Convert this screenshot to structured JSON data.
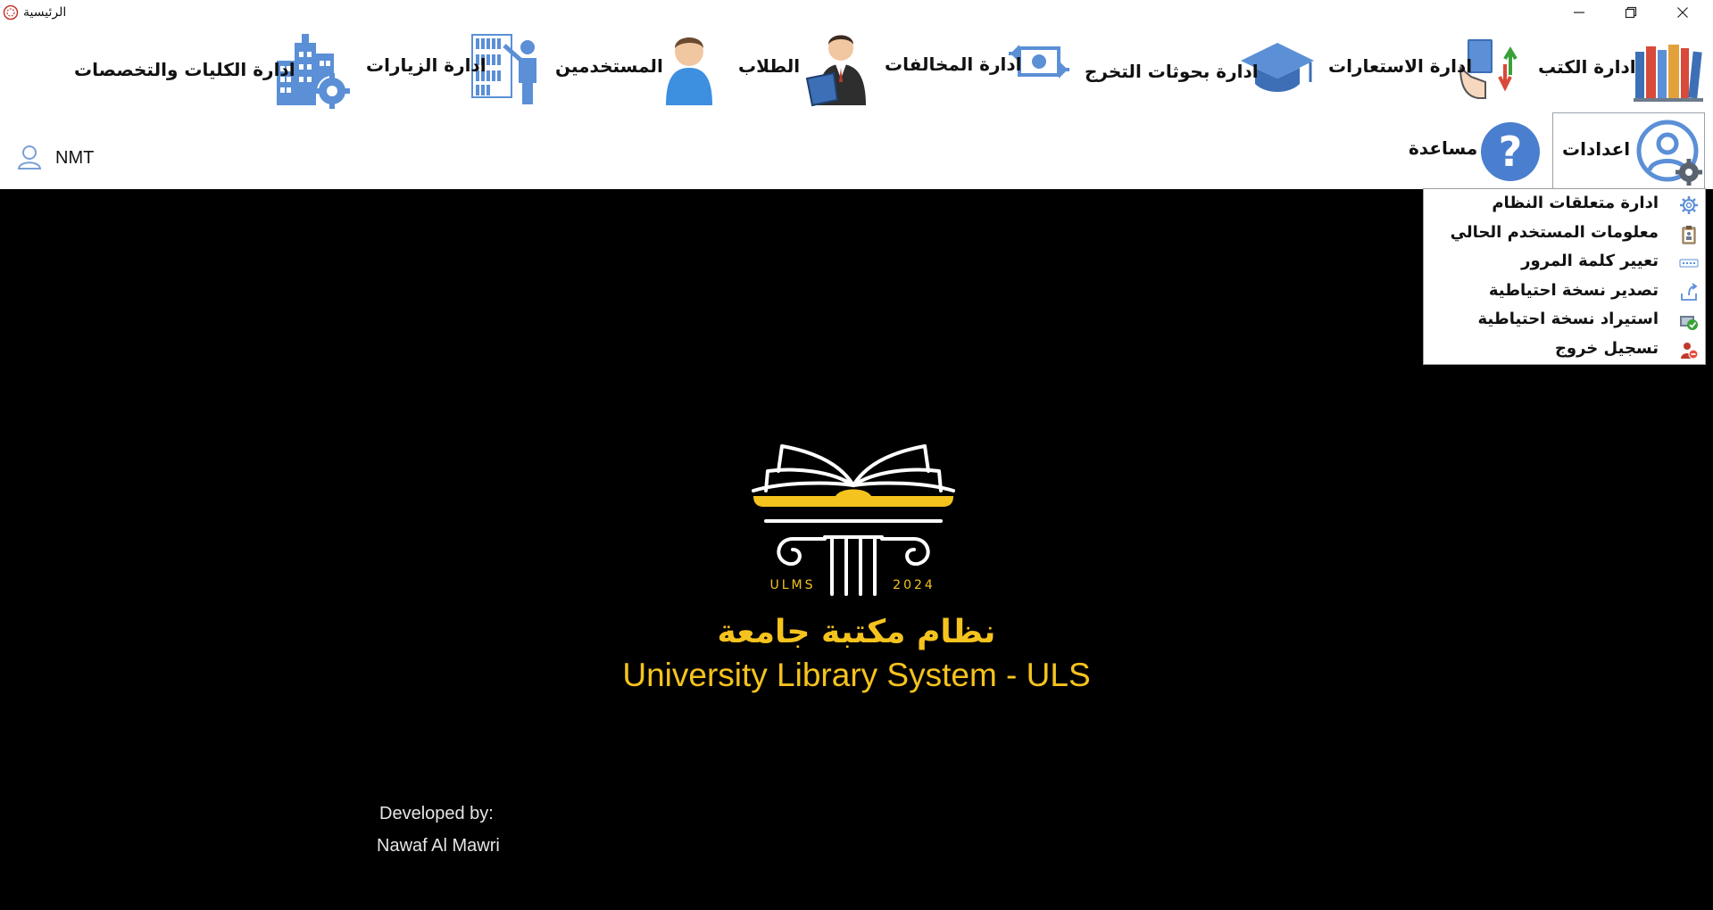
{
  "window": {
    "title": "الرئيسية"
  },
  "toolbar": {
    "items": [
      {
        "label": "ادارة الكتب",
        "icon": "books-icon"
      },
      {
        "label": "ادارة الاستعارات",
        "icon": "borrow-book-icon"
      },
      {
        "label": "ادارة بحوثات التخرج",
        "icon": "graduation-cap-icon"
      },
      {
        "label": "ادارة المخالفات",
        "icon": "money-exchange-icon"
      },
      {
        "label": "الطلاب",
        "icon": "student-reading-icon"
      },
      {
        "label": "المستخدمين",
        "icon": "user-icon"
      },
      {
        "label": "ادارة الزيارات",
        "icon": "library-visitor-icon"
      },
      {
        "label": "ادارة الكليات والتخصصات",
        "icon": "building-gear-icon"
      }
    ],
    "second_row": [
      {
        "label": "اعدادات",
        "icon": "user-settings-icon"
      },
      {
        "label": "مساعدة",
        "icon": "help-icon"
      }
    ],
    "current_user": "NMT"
  },
  "settings_menu": {
    "items": [
      {
        "label": "ادارة متعلقات النظام",
        "icon": "gear-icon"
      },
      {
        "label": "معلومات المستخدم الحالي",
        "icon": "clipboard-icon"
      },
      {
        "label": "تعيير كلمة المرور",
        "icon": "password-field-icon"
      },
      {
        "label": "تصدير نسخة احتياطية",
        "icon": "export-backup-icon"
      },
      {
        "label": "استيراد نسخة احتياطية",
        "icon": "import-backup-icon"
      },
      {
        "label": "تسجيل خروج",
        "icon": "logout-icon"
      }
    ]
  },
  "splash": {
    "logo_left_text": "ULMS",
    "logo_right_text": "2024",
    "title_ar": "نظام مكتبة جامعة",
    "title_en": "University Library System - ULS",
    "developed_by_label": "Developed by:",
    "developer_name": "Nawaf Al Mawri"
  },
  "colors": {
    "accent_yellow": "#f5c31d",
    "icon_blue": "#5b8fd6",
    "background_main": "#000000"
  }
}
